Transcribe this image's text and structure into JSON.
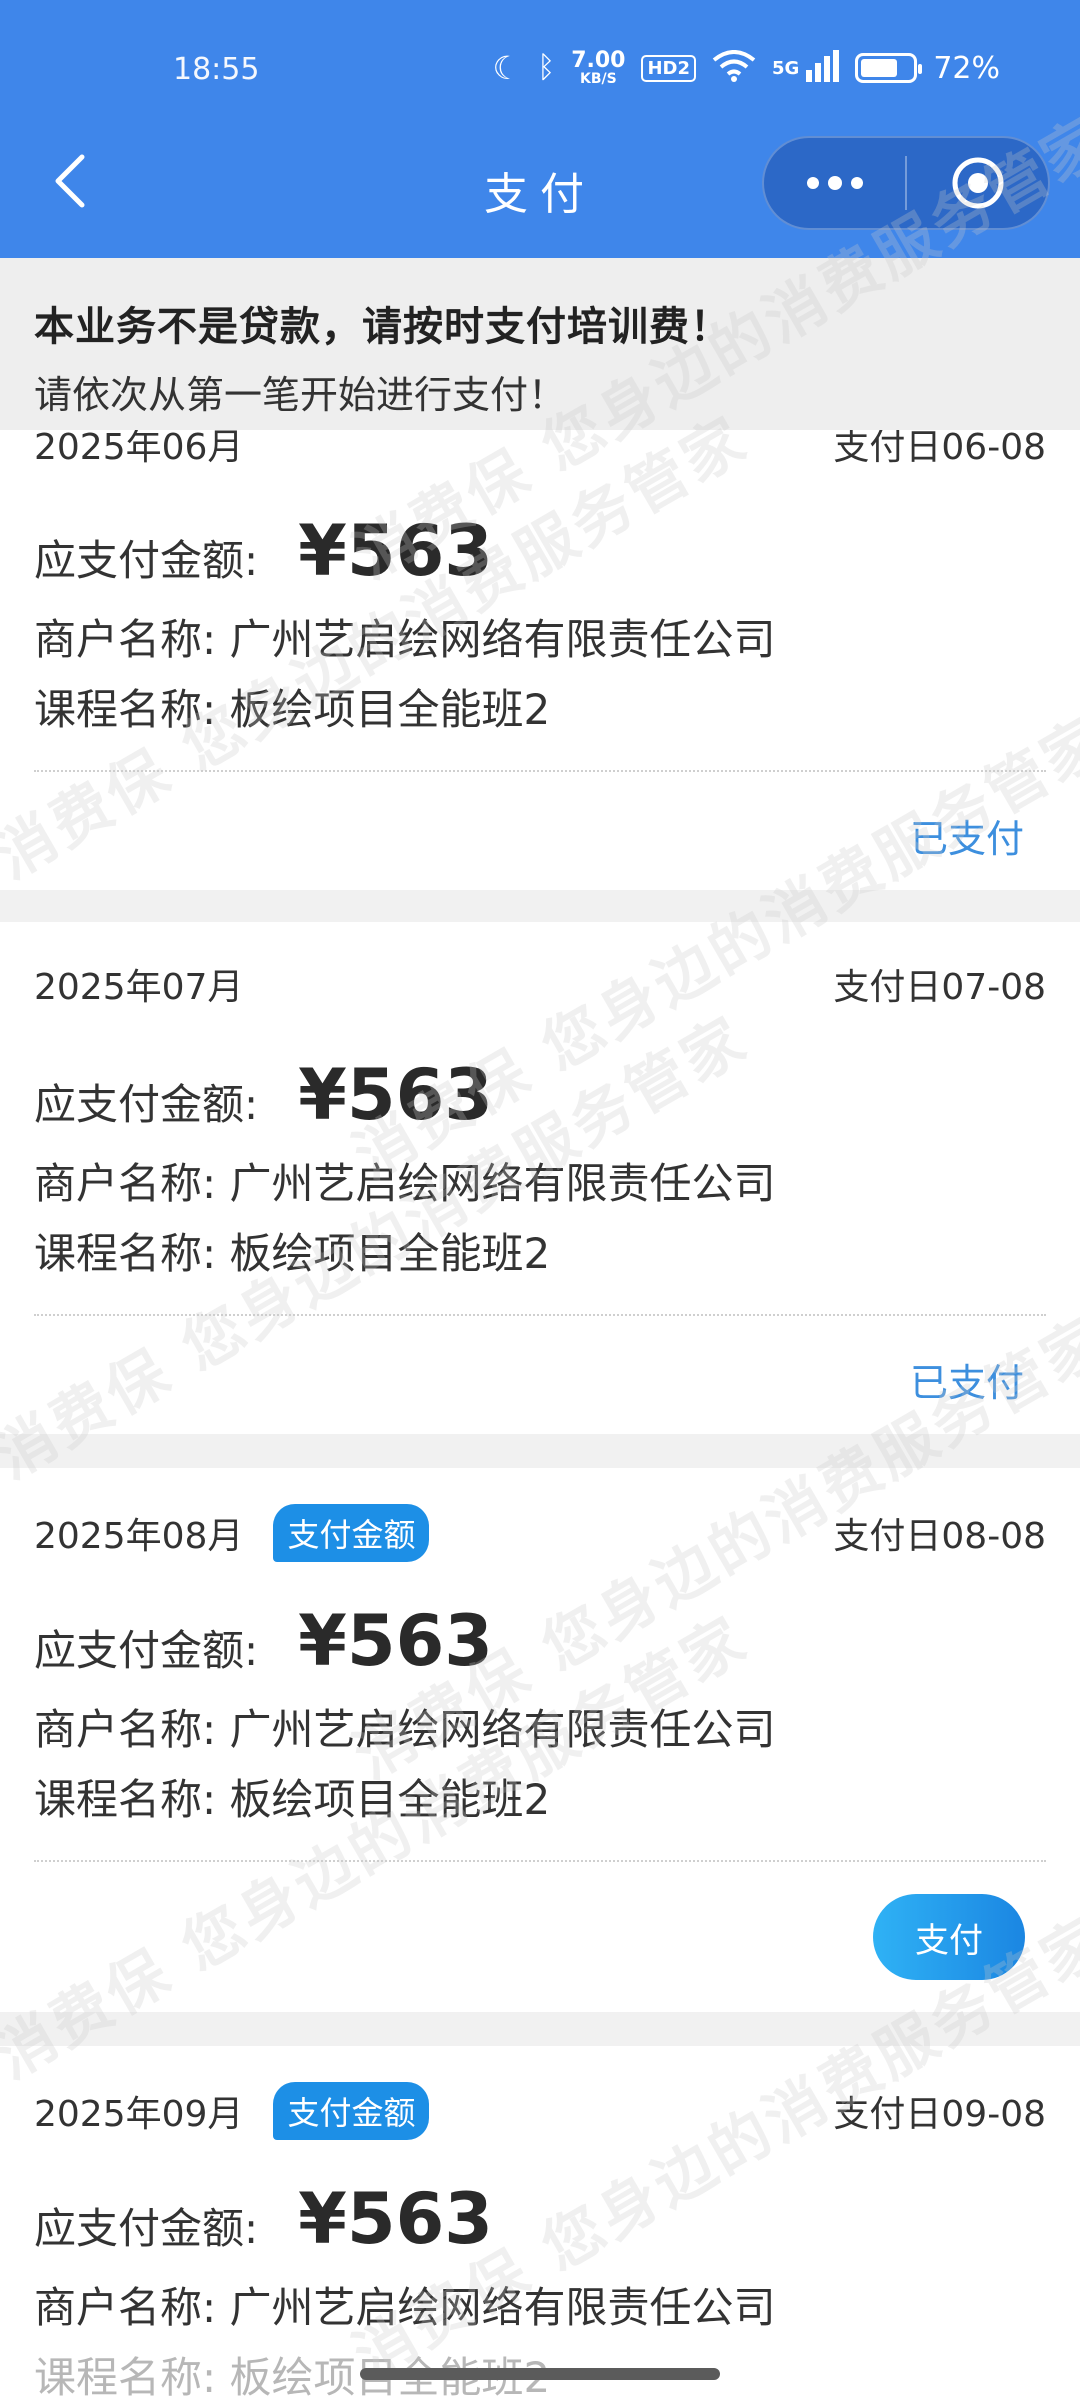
{
  "status_bar": {
    "time": "18:55",
    "speed_value": "7.00",
    "speed_unit": "KB/S",
    "hd": "HD2",
    "network": "5G",
    "battery_level": 0.72,
    "battery_text": "72%"
  },
  "header": {
    "title": "支付"
  },
  "notice": {
    "title": "本业务不是贷款，请按时支付培训费！",
    "subtitle": "请依次从第一笔开始进行支付！"
  },
  "labels": {
    "amount": "应支付金额:",
    "merchant": "商户名称:",
    "course": "课程名称:"
  },
  "watermark_text": "消费保 您身边的消费服务管家",
  "cards": [
    {
      "month": "2025年06月",
      "due_date": "支付日06-08",
      "badge": "",
      "amount": "¥563",
      "merchant": "广州艺启绘网络有限责任公司",
      "course": "板绘项目全能班2",
      "status": "已支付"
    },
    {
      "month": "2025年07月",
      "due_date": "支付日07-08",
      "badge": "",
      "amount": "¥563",
      "merchant": "广州艺启绘网络有限责任公司",
      "course": "板绘项目全能班2",
      "status": "已支付"
    },
    {
      "month": "2025年08月",
      "due_date": "支付日08-08",
      "badge": "支付金额",
      "amount": "¥563",
      "merchant": "广州艺启绘网络有限责任公司",
      "course": "板绘项目全能班2",
      "pay_button": "支付"
    },
    {
      "month": "2025年09月",
      "due_date": "支付日09-08",
      "badge": "支付金额",
      "amount": "¥563",
      "merchant": "广州艺启绘网络有限责任公司",
      "course": "板绘项目全能班2"
    }
  ]
}
